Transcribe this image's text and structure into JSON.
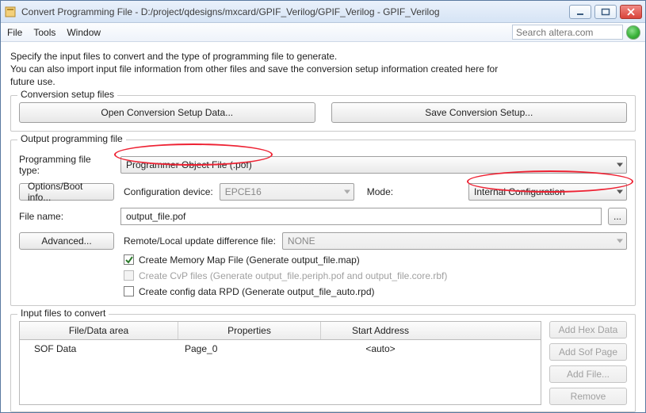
{
  "window": {
    "title": "Convert Programming File - D:/project/qdesigns/mxcard/GPIF_Verilog/GPIF_Verilog - GPIF_Verilog"
  },
  "menubar": {
    "file": "File",
    "tools": "Tools",
    "window": "Window",
    "search_placeholder": "Search altera.com"
  },
  "intro": {
    "l1": "Specify the input files to convert and the type of programming file to generate.",
    "l2": "You can also import input file information from other files and save the conversion setup information created here for",
    "l3": "future use."
  },
  "groups": {
    "conversion_setup": {
      "legend": "Conversion setup files",
      "open_btn": "Open Conversion Setup Data...",
      "save_btn": "Save Conversion Setup..."
    },
    "output": {
      "legend": "Output programming file",
      "prog_file_type_label": "Programming file type:",
      "prog_file_type_value": "Programmer Object File (.pof)",
      "options_btn": "Options/Boot info...",
      "config_device_label": "Configuration device:",
      "config_device_value": "EPCE16",
      "mode_label": "Mode:",
      "mode_value": "Internal Configuration",
      "file_name_label": "File name:",
      "file_name_value": "output_file.pof",
      "browse_btn": "...",
      "advanced_btn": "Advanced...",
      "remote_label": "Remote/Local update difference file:",
      "remote_value": "NONE",
      "cb_memmap": "Create Memory Map File (Generate output_file.map)",
      "cb_cvp": "Create CvP files (Generate output_file.periph.pof and output_file.core.rbf)",
      "cb_rpd": "Create config data RPD (Generate output_file_auto.rpd)"
    },
    "input": {
      "legend": "Input files to convert",
      "th1": "File/Data area",
      "th2": "Properties",
      "th3": "Start Address",
      "row1_c1": "SOF Data",
      "row1_c2": "Page_0",
      "row1_c3": "<auto>",
      "btn_hex": "Add Hex Data",
      "btn_sof": "Add Sof Page",
      "btn_file": "Add File...",
      "btn_remove": "Remove"
    }
  }
}
